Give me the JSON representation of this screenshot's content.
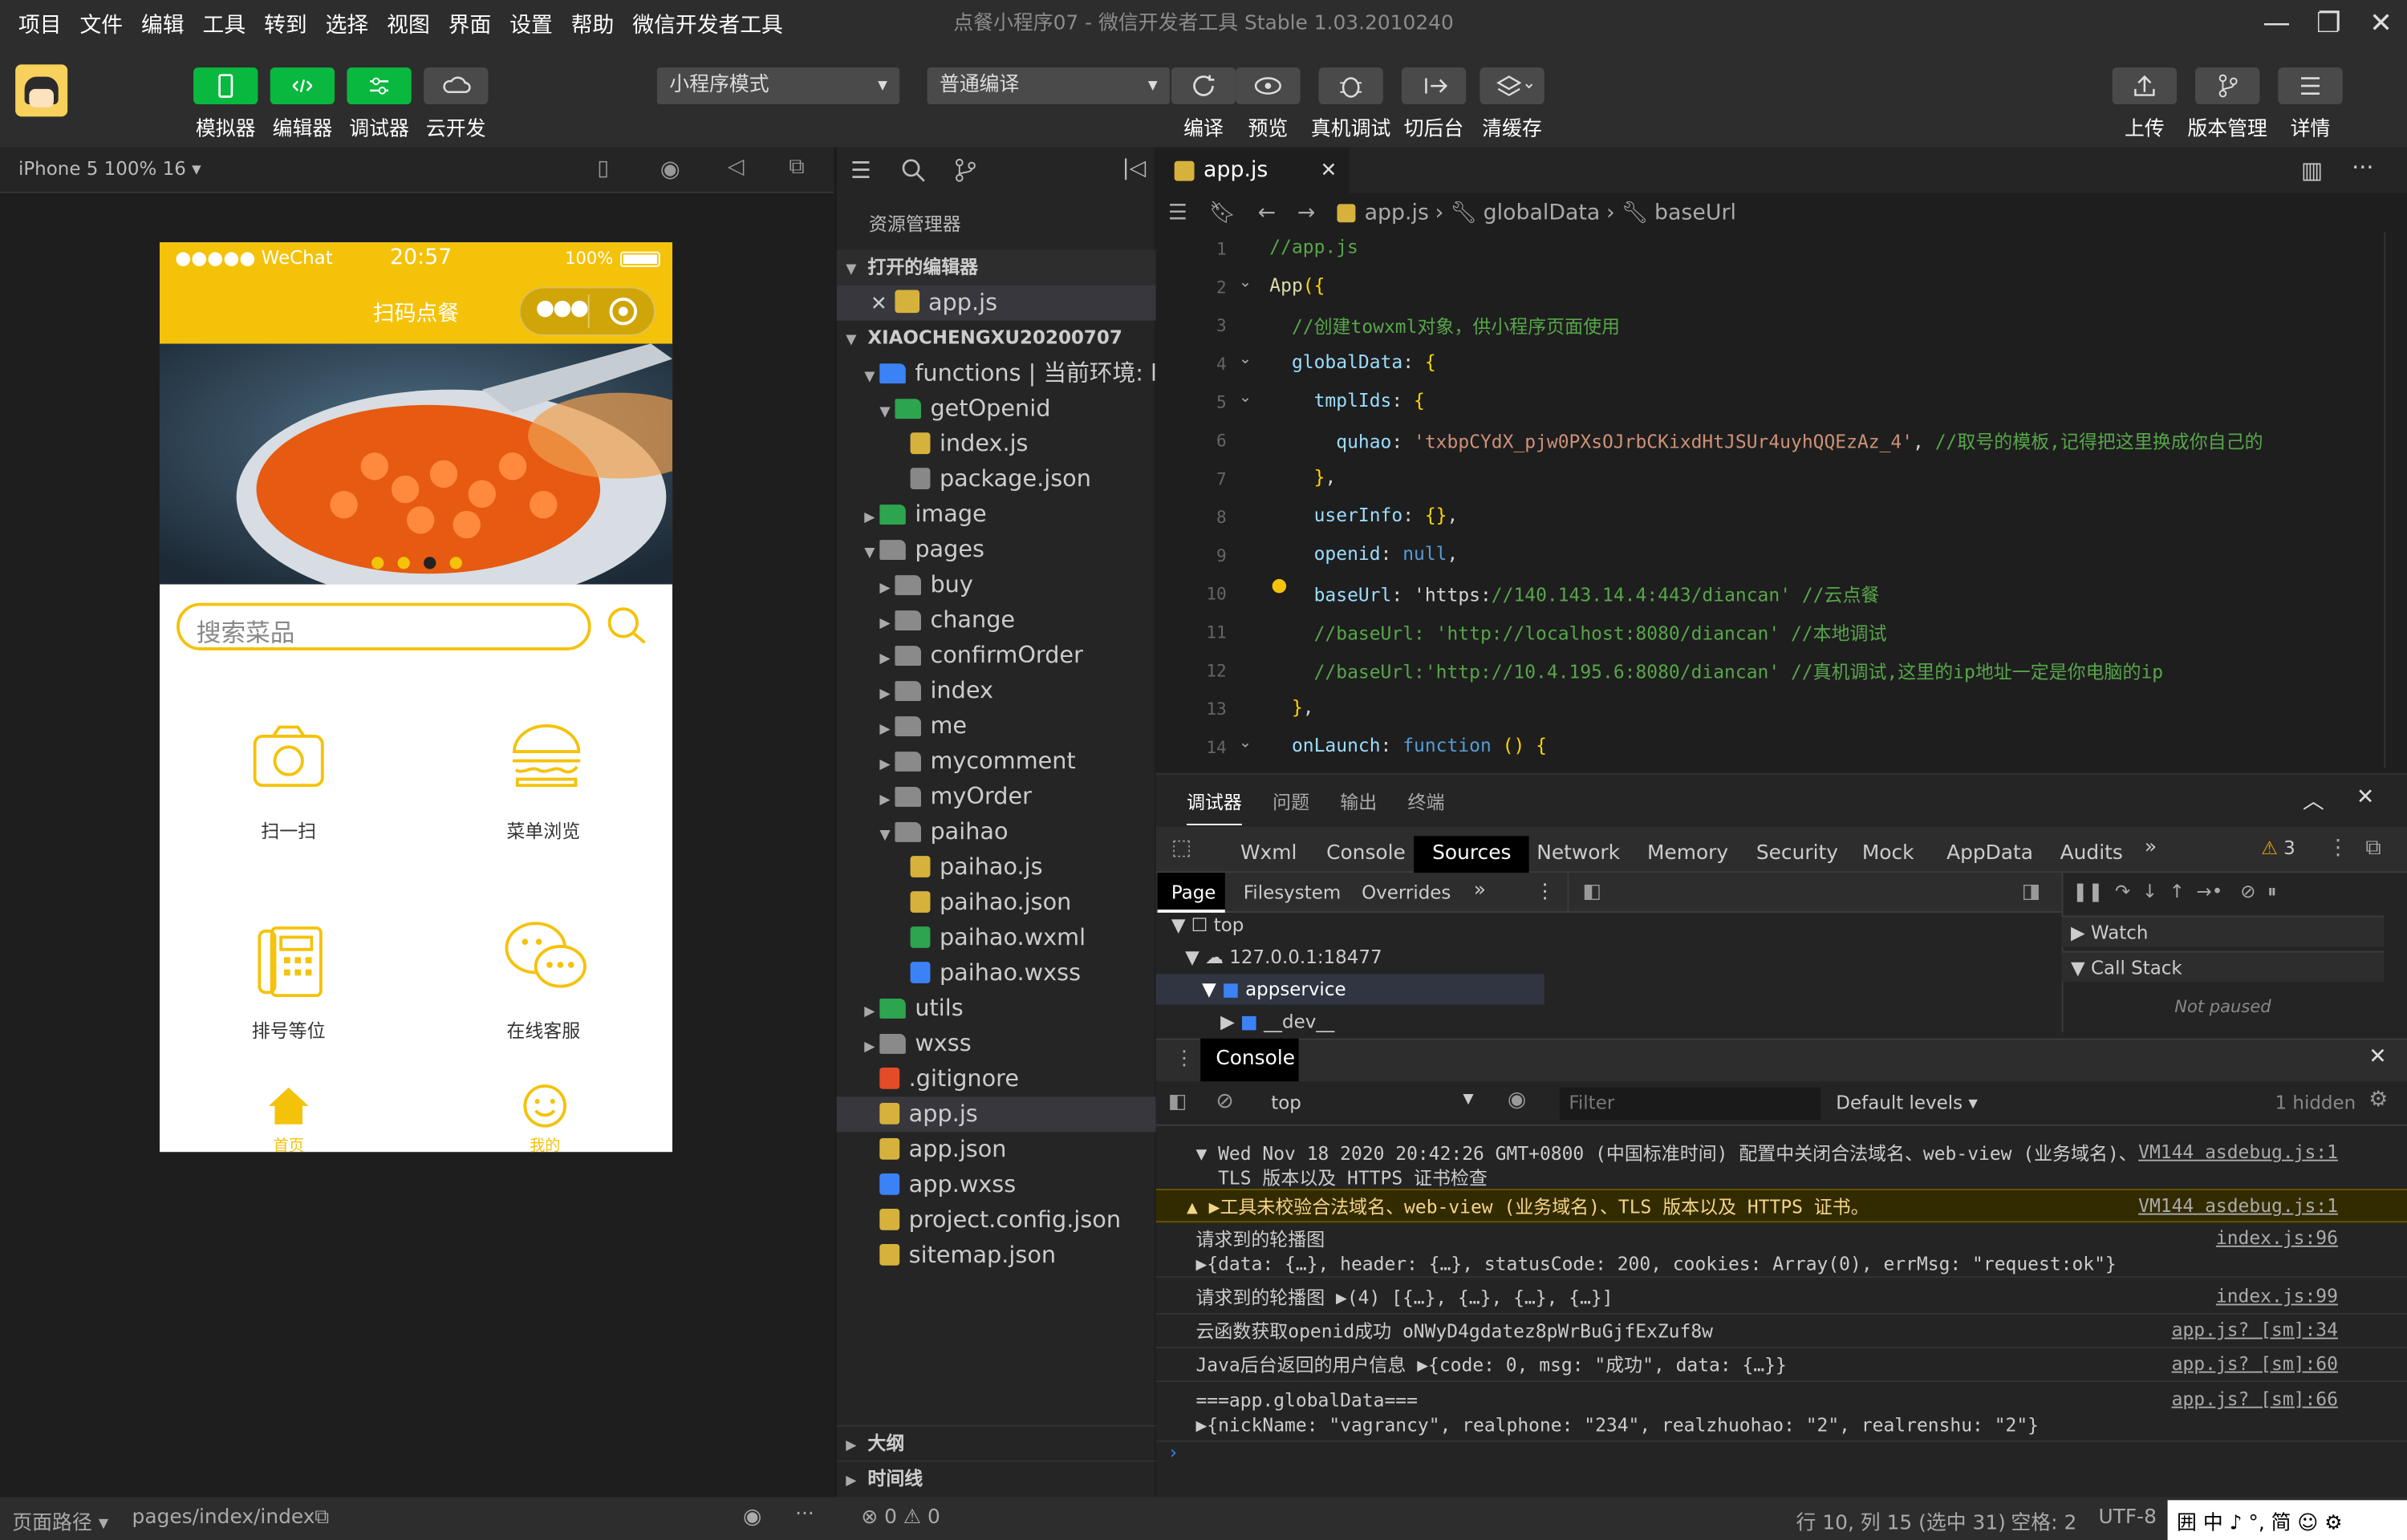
{
  "menu": [
    "项目",
    "文件",
    "编辑",
    "工具",
    "转到",
    "选择",
    "视图",
    "界面",
    "设置",
    "帮助",
    "微信开发者工具"
  ],
  "window_title": "点餐小程序07 - 微信开发者工具 Stable 1.03.2010240",
  "toolbar": {
    "modes": [
      "模拟器",
      "编辑器",
      "调试器",
      "云开发"
    ],
    "mode_select": "小程序模式",
    "compile_select": "普通编译",
    "actions": [
      "编译",
      "预览",
      "真机调试",
      "切后台",
      "清缓存"
    ],
    "right": [
      "上传",
      "版本管理",
      "详情"
    ]
  },
  "sim": {
    "device": "iPhone 5 100% 16 ▾",
    "status_left": "●●●●● WeChat",
    "status_time": "20:57",
    "status_right": "100%",
    "nav_title": "扫码点餐",
    "search_placeholder": "搜索菜品",
    "grid": [
      "扫一扫",
      "菜单浏览",
      "排号等位",
      "在线客服"
    ],
    "tabs": [
      "首页",
      "我的"
    ]
  },
  "explorer": {
    "title": "资源管理器",
    "open_editors": "打开的编辑器",
    "open_file": "app.js",
    "project": "XIAOCHENGXU20200707",
    "tree": [
      {
        "name": "functions | 当前环境: l...",
        "d": 1,
        "open": true,
        "type": "cloud"
      },
      {
        "name": "getOpenid",
        "d": 2,
        "open": true,
        "type": "cloudfn"
      },
      {
        "name": "index.js",
        "d": 3,
        "type": "js"
      },
      {
        "name": "package.json",
        "d": 3,
        "type": "pkg"
      },
      {
        "name": "image",
        "d": 1,
        "open": false,
        "type": "img"
      },
      {
        "name": "pages",
        "d": 1,
        "open": true,
        "type": "folder"
      },
      {
        "name": "buy",
        "d": 2,
        "open": false,
        "type": "folder"
      },
      {
        "name": "change",
        "d": 2,
        "open": false,
        "type": "folder"
      },
      {
        "name": "confirmOrder",
        "d": 2,
        "open": false,
        "type": "folder"
      },
      {
        "name": "index",
        "d": 2,
        "open": false,
        "type": "folder"
      },
      {
        "name": "me",
        "d": 2,
        "open": false,
        "type": "folder"
      },
      {
        "name": "mycomment",
        "d": 2,
        "open": false,
        "type": "folder"
      },
      {
        "name": "myOrder",
        "d": 2,
        "open": false,
        "type": "folder"
      },
      {
        "name": "paihao",
        "d": 2,
        "open": true,
        "type": "folder"
      },
      {
        "name": "paihao.js",
        "d": 3,
        "type": "js"
      },
      {
        "name": "paihao.json",
        "d": 3,
        "type": "json"
      },
      {
        "name": "paihao.wxml",
        "d": 3,
        "type": "wxml"
      },
      {
        "name": "paihao.wxss",
        "d": 3,
        "type": "wxss"
      },
      {
        "name": "utils",
        "d": 1,
        "open": false,
        "type": "img"
      },
      {
        "name": "wxss",
        "d": 1,
        "open": false,
        "type": "folder"
      },
      {
        "name": ".gitignore",
        "d": 1,
        "type": "git"
      },
      {
        "name": "app.js",
        "d": 1,
        "type": "js",
        "sel": true
      },
      {
        "name": "app.json",
        "d": 1,
        "type": "json"
      },
      {
        "name": "app.wxss",
        "d": 1,
        "type": "wxss"
      },
      {
        "name": "project.config.json",
        "d": 1,
        "type": "json"
      },
      {
        "name": "sitemap.json",
        "d": 1,
        "type": "json"
      }
    ],
    "outline": "大纲",
    "timeline": "时间线"
  },
  "editor": {
    "tab": "app.js",
    "breadcrumb": [
      "app.js",
      "globalData",
      "baseUrl"
    ],
    "lines": [
      "//app.js",
      "App({",
      "  //创建towxml对象，供小程序页面使用",
      "  globalData: {",
      "    tmplIds: {",
      "      quhao: 'txbpCYdX_pjw0PXsOJrbCKixdHtJSUr4uyhQQEzAz_4', //取号的模板,记得把这里换成你自己的",
      "    },",
      "    userInfo: {},",
      "    openid: null,",
      "    baseUrl: 'https://140.143.14.4:443/diancan' //云点餐",
      "    //baseUrl: 'http://localhost:8080/diancan' //本地调试",
      "    //baseUrl:'http://10.4.195.6:8080/diancan' //真机调试,这里的ip地址一定是你电脑的ip",
      "  },",
      "  onLaunch: function () {"
    ]
  },
  "devtools": {
    "panel_tabs": [
      "调试器",
      "问题",
      "输出",
      "终端"
    ],
    "tabs": [
      "Wxml",
      "Console",
      "Sources",
      "Network",
      "Memory",
      "Security",
      "Mock",
      "AppData",
      "Audits"
    ],
    "warn_count": "3",
    "sub_tabs": [
      "Page",
      "Filesystem",
      "Overrides"
    ],
    "tree": [
      "top",
      "127.0.0.1:18477",
      "appservice",
      "__dev__"
    ],
    "watch": "Watch",
    "callstack": "Call Stack",
    "not_paused": "Not paused",
    "console_tab": "Console",
    "context": "top",
    "filter": "Filter",
    "levels": "Default levels ▾",
    "hidden": "1 hidden",
    "logs": [
      {
        "t": "▼ Wed Nov 18 2020 20:42:26 GMT+0800 (中国标准时间) 配置中关闭合法域名、web-view (业务域名)、\n  TLS 版本以及 HTTPS 证书检查",
        "src": "VM144 asdebug.js:1"
      },
      {
        "t": "▲ ▶工具未校验合法域名、web-view (业务域名)、TLS 版本以及 HTTPS 证书。",
        "src": "VM144 asdebug.js:1",
        "warn": true
      },
      {
        "t": "请求到的轮播图\n▶{data: {…}, header: {…}, statusCode: 200, cookies: Array(0), errMsg: \"request:ok\"}",
        "src": "index.js:96"
      },
      {
        "t": "请求到的轮播图 ▶(4) [{…}, {…}, {…}, {…}]",
        "src": "index.js:99"
      },
      {
        "t": "云函数获取openid成功 oNWyD4gdatez8pWrBuGjfExZuf8w",
        "src": "app.js? [sm]:34"
      },
      {
        "t": "Java后台返回的用户信息 ▶{code: 0, msg: \"成功\", data: {…}}",
        "src": "app.js? [sm]:60"
      },
      {
        "t": "===app.globalData===\n▶{nickName: \"vagrancy\", realphone: \"234\", realzhuohao: \"2\", realrenshu: \"2\"}",
        "src": "app.js? [sm]:66"
      }
    ]
  },
  "status": {
    "path_label": "页面路径 ▾",
    "path": "pages/index/index",
    "errors": "⊗ 0 ⚠ 0",
    "pos": "行 10, 列 15 (选中 31)",
    "spaces": "空格: 2",
    "enc": "UTF-8",
    "ime": "囲 中 ♪ °, 简 ☺ ⚙"
  },
  "colors": {
    "accent": "#09b83e",
    "brand": "#f5c20a"
  }
}
